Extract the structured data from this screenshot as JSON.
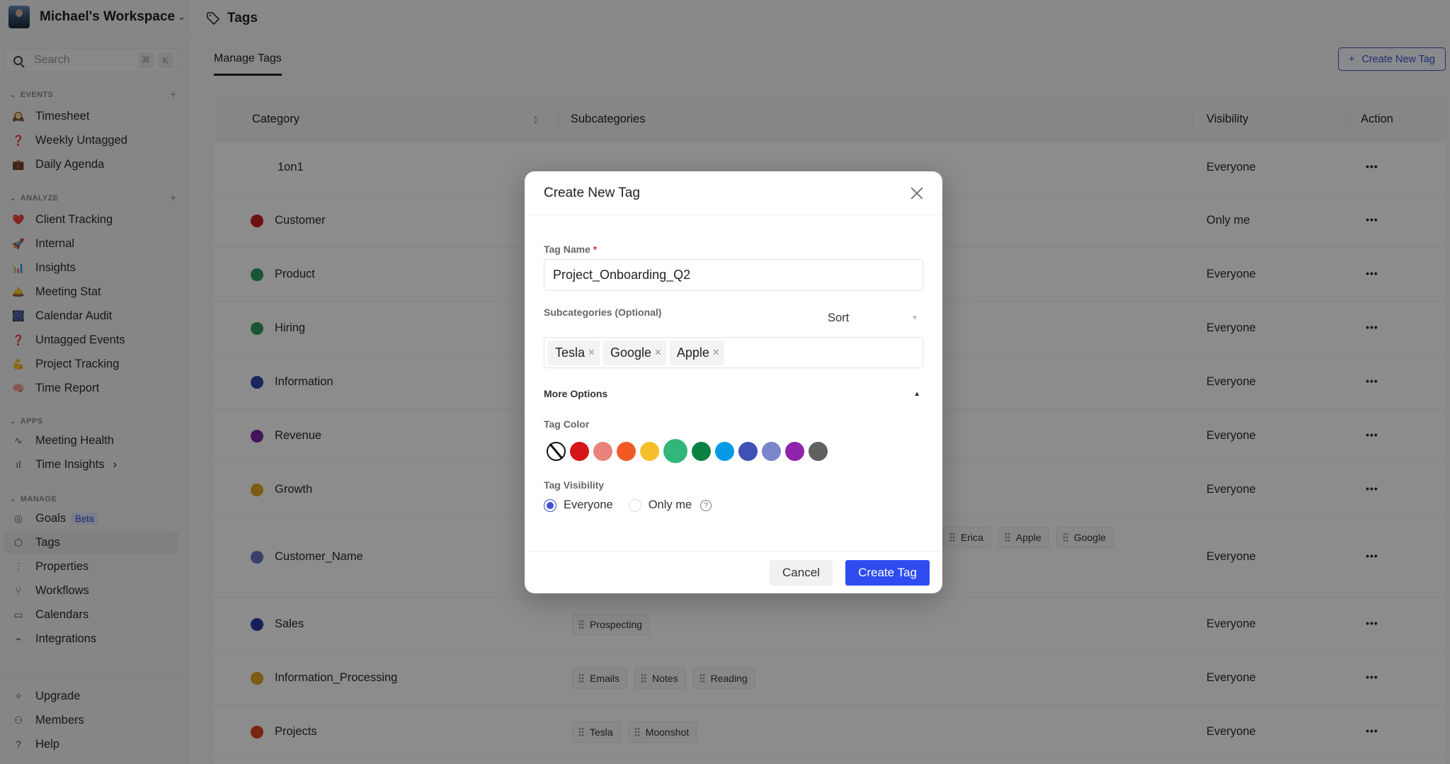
{
  "workspace": {
    "name": "Michael's Workspace"
  },
  "search": {
    "placeholder": "Search",
    "shortcut_mod": "⌘",
    "shortcut_key": "K"
  },
  "sidebar": {
    "events": {
      "title": "EVENTS",
      "items": [
        {
          "label": "Timesheet",
          "icon": "🕰️"
        },
        {
          "label": "Weekly Untagged",
          "icon": "❓"
        },
        {
          "label": "Daily Agenda",
          "icon": "💼"
        }
      ]
    },
    "analyze": {
      "title": "ANALYZE",
      "items": [
        {
          "label": "Client Tracking",
          "icon": "❤️"
        },
        {
          "label": "Internal",
          "icon": "🚀"
        },
        {
          "label": "Insights",
          "icon": "📊"
        },
        {
          "label": "Meeting Stat",
          "icon": "🛎️"
        },
        {
          "label": "Calendar Audit",
          "icon": "🎆"
        },
        {
          "label": "Untagged Events",
          "icon": "❓"
        },
        {
          "label": "Project Tracking",
          "icon": "💪"
        },
        {
          "label": "Time Report",
          "icon": "🧠"
        }
      ]
    },
    "apps": {
      "title": "APPS",
      "items": [
        {
          "label": "Meeting Health",
          "icon": "∿"
        },
        {
          "label": "Time Insights",
          "icon": "ıl",
          "chevron": "›"
        }
      ]
    },
    "manage": {
      "title": "MANAGE",
      "items": [
        {
          "label": "Goals",
          "icon": "◎",
          "badge": "Beta"
        },
        {
          "label": "Tags",
          "icon": "⬡",
          "active": true
        },
        {
          "label": "Properties",
          "icon": "⫶"
        },
        {
          "label": "Workflows",
          "icon": "⑂"
        },
        {
          "label": "Calendars",
          "icon": "▭"
        },
        {
          "label": "Integrations",
          "icon": "⌁"
        }
      ]
    },
    "bottom": [
      {
        "label": "Upgrade",
        "icon": "✧"
      },
      {
        "label": "Members",
        "icon": "⚇"
      },
      {
        "label": "Help",
        "icon": "?"
      }
    ]
  },
  "page": {
    "title": "Tags",
    "tab": "Manage Tags",
    "create_button": "Create New Tag"
  },
  "table": {
    "columns": [
      "Category",
      "Subcategories",
      "Visibility",
      "Action"
    ],
    "rows": [
      {
        "category": "1on1",
        "color": null,
        "subcategories": [],
        "visibility": "Everyone"
      },
      {
        "category": "Customer",
        "color": "#c62020",
        "subcategories": [],
        "visibility": "Only me"
      },
      {
        "category": "Product",
        "color": "#2e9b5f",
        "subcategories": [],
        "visibility": "Everyone"
      },
      {
        "category": "Hiring",
        "color": "#2e9b5f",
        "subcategories": [],
        "visibility": "Everyone"
      },
      {
        "category": "Information",
        "color": "#3346a8",
        "subcategories": [],
        "visibility": "Everyone"
      },
      {
        "category": "Revenue",
        "color": "#7b25a0",
        "subcategories": [],
        "visibility": "Everyone"
      },
      {
        "category": "Growth",
        "color": "#e0a824",
        "subcategories": [],
        "visibility": "Everyone"
      },
      {
        "category": "Customer_Name",
        "color": "#6676c4",
        "subcategories": [
          "Erica",
          "Apple",
          "Google"
        ],
        "visibility": "Everyone"
      },
      {
        "category": "Sales",
        "color": "#2a3aa6",
        "subcategories": [
          "Prospecting"
        ],
        "visibility": "Everyone"
      },
      {
        "category": "Information_Processing",
        "color": "#e0a824",
        "subcategories": [
          "Emails",
          "Notes",
          "Reading"
        ],
        "visibility": "Everyone"
      },
      {
        "category": "Projects",
        "color": "#d9451f",
        "subcategories": [
          "Tesla",
          "Moonshot"
        ],
        "visibility": "Everyone"
      }
    ],
    "action_label": "•••"
  },
  "modal": {
    "title": "Create New Tag",
    "tag_name_label": "Tag Name",
    "required_mark": "*",
    "tag_name_value": "Project_Onboarding_Q2",
    "subcategories_label": "Subcategories (Optional)",
    "sort_label": "Sort",
    "subcategories": [
      "Tesla",
      "Google",
      "Apple"
    ],
    "more_options_label": "More Options",
    "tag_color_label": "Tag Color",
    "colors": [
      "none",
      "#d7141a",
      "#e8827a",
      "#f15a24",
      "#f6be2b",
      "#33b679",
      "#0b8043",
      "#039be5",
      "#3f51b5",
      "#7986cb",
      "#8e24aa",
      "#616161"
    ],
    "selected_color": "#33b679",
    "tag_visibility_label": "Tag Visibility",
    "visibility_options": [
      "Everyone",
      "Only me"
    ],
    "visibility_selected": "Everyone",
    "cancel_label": "Cancel",
    "create_label": "Create Tag"
  }
}
